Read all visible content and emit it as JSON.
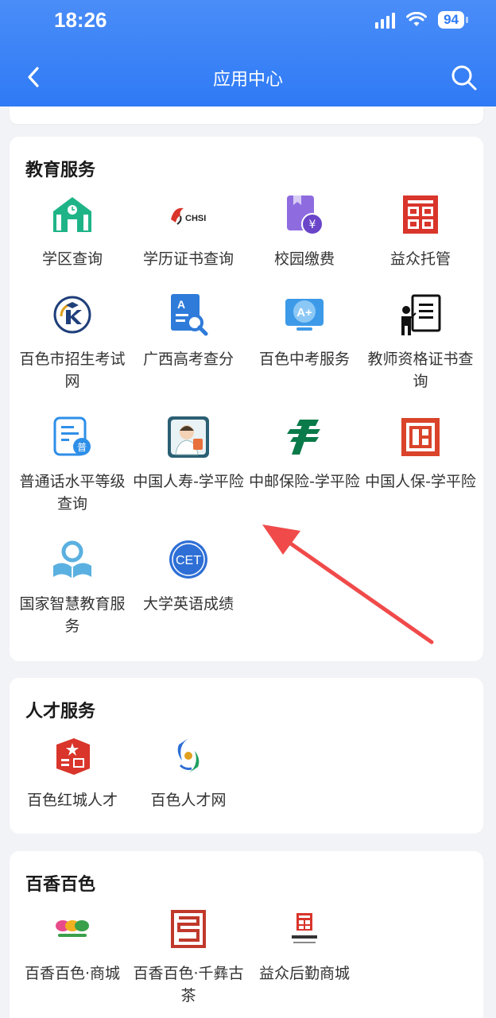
{
  "status_bar": {
    "time": "18:26",
    "battery": "94"
  },
  "nav": {
    "title": "应用中心"
  },
  "sections": [
    {
      "title": "教育服务",
      "items": [
        {
          "label": "学区查询",
          "icon": "school-icon"
        },
        {
          "label": "学历证书查询",
          "icon": "chsi-logo-icon"
        },
        {
          "label": "校园缴费",
          "icon": "payment-icon"
        },
        {
          "label": "益众托管",
          "icon": "yizhong-logo-icon"
        },
        {
          "label": "百色市招生考试网",
          "icon": "exam-logo-icon"
        },
        {
          "label": "广西高考查分",
          "icon": "score-search-icon"
        },
        {
          "label": "百色中考服务",
          "icon": "monitor-a-plus-icon"
        },
        {
          "label": "教师资格证书查询",
          "icon": "teacher-icon"
        },
        {
          "label": "普通话水平等级查询",
          "icon": "mandarin-doc-icon"
        },
        {
          "label": "中国人寿-学平险",
          "icon": "china-life-icon"
        },
        {
          "label": "中邮保险-学平险",
          "icon": "china-post-icon"
        },
        {
          "label": "中国人保-学平险",
          "icon": "picc-icon"
        },
        {
          "label": "国家智慧教育服务",
          "icon": "smart-edu-icon"
        },
        {
          "label": "大学英语成绩",
          "icon": "cet-icon"
        }
      ]
    },
    {
      "title": "人才服务",
      "items": [
        {
          "label": "百色红城人才",
          "icon": "red-city-talent-icon"
        },
        {
          "label": "百色人才网",
          "icon": "talent-net-icon"
        }
      ]
    },
    {
      "title": "百香百色",
      "items": [
        {
          "label": "百香百色·商城",
          "icon": "baixiang-logo-icon"
        },
        {
          "label": "百香百色·千彝古茶",
          "icon": "ancient-tea-icon"
        },
        {
          "label": "益众后勤商城",
          "icon": "logistics-mall-icon"
        }
      ]
    }
  ],
  "icon_text": {
    "chsi": "CHSI",
    "cet": "CET",
    "pu": "普",
    "yen": "¥",
    "aplus": "A+",
    "a": "A"
  },
  "colors": {
    "header": "#2f7af5",
    "arrow": "#f04a4a",
    "teal": "#1fb487",
    "red": "#d9352b",
    "purple": "#7c58d6",
    "blue": "#2e7bd9"
  }
}
